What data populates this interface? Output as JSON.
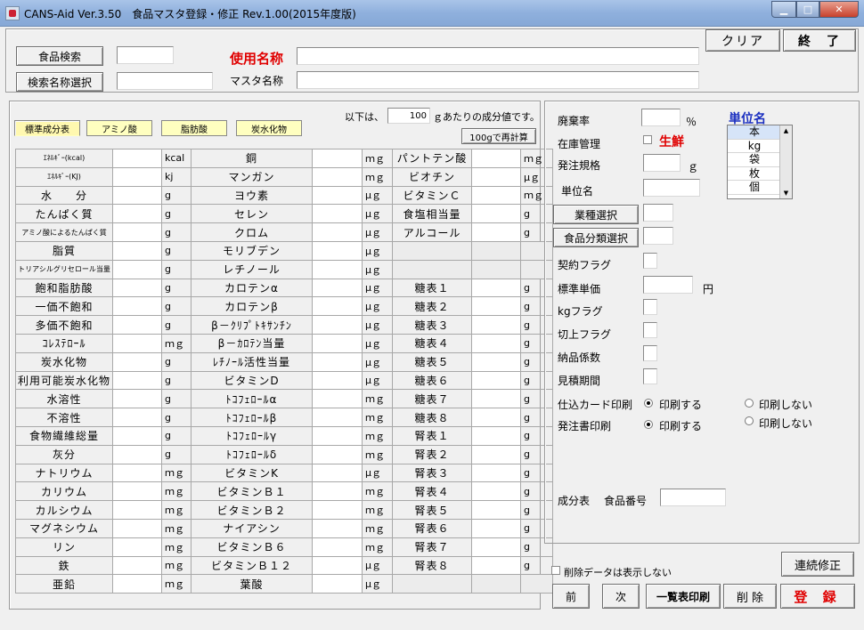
{
  "window": {
    "title": "CANS-Aid Ver.3.50　食品マスタ登録・修正 Rev.1.00(2015年度版)",
    "minimize": "▁",
    "maximize": "□",
    "close": "✕"
  },
  "top": {
    "clear": "クリア",
    "exit": "終　了",
    "food_search": "食品検索",
    "search_name_select": "検索名称選択",
    "use_name_label": "使用名称",
    "master_name_label": "マスタ名称"
  },
  "nutrient": {
    "tabs": [
      "標準成分表",
      "アミノ酸",
      "脂肪酸",
      "炭水化物"
    ],
    "basis_prefix": "以下は、",
    "basis_value": "100",
    "basis_suffix": "ｇあたりの成分値です。",
    "recalc": "100gで再計算",
    "col1": [
      [
        "ｴﾈﾙｷﾞｰ(kcal)",
        "kcal"
      ],
      [
        "ｴﾈﾙｷﾞｰ(KJ)",
        "kj"
      ],
      [
        "水　　分",
        "g"
      ],
      [
        "たんぱく質",
        "g"
      ],
      [
        "アミノ酸によるたんぱく質",
        "g"
      ],
      [
        "脂質",
        "g"
      ],
      [
        "トリアシルグリセロール当量",
        "g"
      ],
      [
        "飽和脂肪酸",
        "g"
      ],
      [
        "一価不飽和",
        "g"
      ],
      [
        "多価不飽和",
        "g"
      ],
      [
        "ｺﾚｽﾃﾛｰﾙ",
        "ｍｇ"
      ],
      [
        "炭水化物",
        "g"
      ],
      [
        "利用可能炭水化物",
        "g"
      ],
      [
        "水溶性",
        "g"
      ],
      [
        "不溶性",
        "g"
      ],
      [
        "食物繊維総量",
        "g"
      ],
      [
        "灰分",
        "g"
      ],
      [
        "ナトリウム",
        "ｍｇ"
      ],
      [
        "カリウム",
        "ｍｇ"
      ],
      [
        "カルシウム",
        "ｍｇ"
      ],
      [
        "マグネシウム",
        "ｍｇ"
      ],
      [
        "リン",
        "ｍｇ"
      ],
      [
        "鉄",
        "ｍｇ"
      ],
      [
        "亜鉛",
        "ｍｇ"
      ]
    ],
    "col2": [
      [
        "銅",
        "ｍｇ"
      ],
      [
        "マンガン",
        "ｍｇ"
      ],
      [
        "ヨウ素",
        "μｇ"
      ],
      [
        "セレン",
        "μｇ"
      ],
      [
        "クロム",
        "μｇ"
      ],
      [
        "モリブデン",
        "μｇ"
      ],
      [
        "レチノール",
        "μｇ"
      ],
      [
        "カロテンα",
        "μｇ"
      ],
      [
        "カロテンβ",
        "μｇ"
      ],
      [
        "β－ｸﾘﾌﾟﾄｷｻﾝﾁﾝ",
        "μｇ"
      ],
      [
        "β－ｶﾛﾃﾝ当量",
        "μｇ"
      ],
      [
        "ﾚﾁﾉｰﾙ活性当量",
        "μｇ"
      ],
      [
        "ビタミンD",
        "μｇ"
      ],
      [
        "ﾄｺﾌｪﾛｰﾙα",
        "ｍｇ"
      ],
      [
        "ﾄｺﾌｪﾛｰﾙβ",
        "ｍｇ"
      ],
      [
        "ﾄｺﾌｪﾛｰﾙγ",
        "ｍｇ"
      ],
      [
        "ﾄｺﾌｪﾛｰﾙδ",
        "ｍｇ"
      ],
      [
        "ビタミンK",
        "μｇ"
      ],
      [
        "ビタミンＢ１",
        "ｍｇ"
      ],
      [
        "ビタミンＢ２",
        "ｍｇ"
      ],
      [
        "ナイアシン",
        "ｍｇ"
      ],
      [
        "ビタミンＢ６",
        "ｍｇ"
      ],
      [
        "ビタミンＢ１２",
        "μｇ"
      ],
      [
        "葉酸",
        "μｇ"
      ]
    ],
    "col3": [
      [
        "パントテン酸",
        "ｍｇ"
      ],
      [
        "ビオチン",
        "μｇ"
      ],
      [
        "ビタミンＣ",
        "ｍｇ"
      ],
      [
        "食塩相当量",
        "g"
      ],
      [
        "アルコール",
        "g"
      ],
      [
        "",
        ""
      ],
      [
        "",
        ""
      ],
      [
        "糖表１",
        "g"
      ],
      [
        "糖表２",
        "g"
      ],
      [
        "糖表３",
        "g"
      ],
      [
        "糖表４",
        "g"
      ],
      [
        "糖表５",
        "g"
      ],
      [
        "糖表６",
        "g"
      ],
      [
        "糖表７",
        "g"
      ],
      [
        "糖表８",
        "g"
      ],
      [
        "腎表１",
        "g"
      ],
      [
        "腎表２",
        "g"
      ],
      [
        "腎表３",
        "g"
      ],
      [
        "腎表４",
        "g"
      ],
      [
        "腎表５",
        "g"
      ],
      [
        "腎表６",
        "g"
      ],
      [
        "腎表７",
        "g"
      ],
      [
        "腎表８",
        "g"
      ],
      [
        "",
        ""
      ]
    ]
  },
  "right": {
    "waste_rate": "廃棄率",
    "percent": "％",
    "unit_title": "単位名",
    "units": [
      "本",
      "kg",
      "袋",
      "枚",
      "個"
    ],
    "stock": "在庫管理",
    "fresh": "生鮮",
    "order_spec": "発注規格",
    "gram": "ｇ",
    "unit_name": "単位名",
    "business_select": "業種選択",
    "food_class_select": "食品分類選択",
    "contract_flag": "契約フラグ",
    "std_price": "標準単価",
    "yen": "円",
    "kg_flag": "kgフラグ",
    "roundup_flag": "切上フラグ",
    "delivery_coef": "納品係数",
    "estimate_period": "見積期間",
    "purchase_card": "仕込カード印刷",
    "order_print": "発注書印刷",
    "print_yes": "印刷する",
    "print_no": "印刷しない",
    "comp_table": "成分表",
    "food_number": "食品番号"
  },
  "bottom": {
    "hide_deleted": "削除データは表示しない",
    "continuous_edit": "連続修正",
    "prev": "前",
    "next": "次",
    "list_print": "一覧表印刷",
    "delete": "削 除",
    "register": "登 録"
  }
}
